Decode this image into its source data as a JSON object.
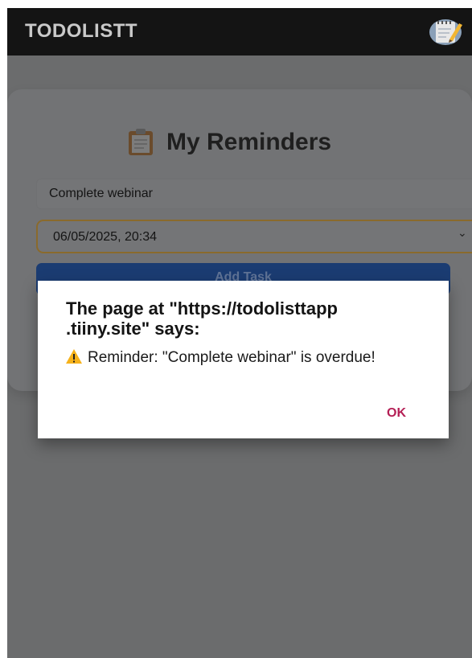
{
  "header": {
    "title": "TODOLISTT",
    "icon": "notepad-pencil-icon"
  },
  "card": {
    "heading": "My Reminders",
    "heading_icon": "clipboard-icon",
    "task_input": {
      "value": "Complete webinar"
    },
    "date_select": {
      "value": "06/05/2025, 20:34"
    },
    "add_button": {
      "label": "Add Task"
    }
  },
  "dialog": {
    "title_line1": "The page at \"https://todolisttapp",
    "title_line2": ".tiiny.site\" says:",
    "message": "Reminder: \"Complete webinar\" is overdue!",
    "message_icon": "warning-icon",
    "ok_label": "OK"
  },
  "colors": {
    "topbar": "#141414",
    "overlay": "#6b6c6d",
    "button": "#1b3c72",
    "ok": "#b41f55",
    "select_border": "#8a6a2c"
  }
}
